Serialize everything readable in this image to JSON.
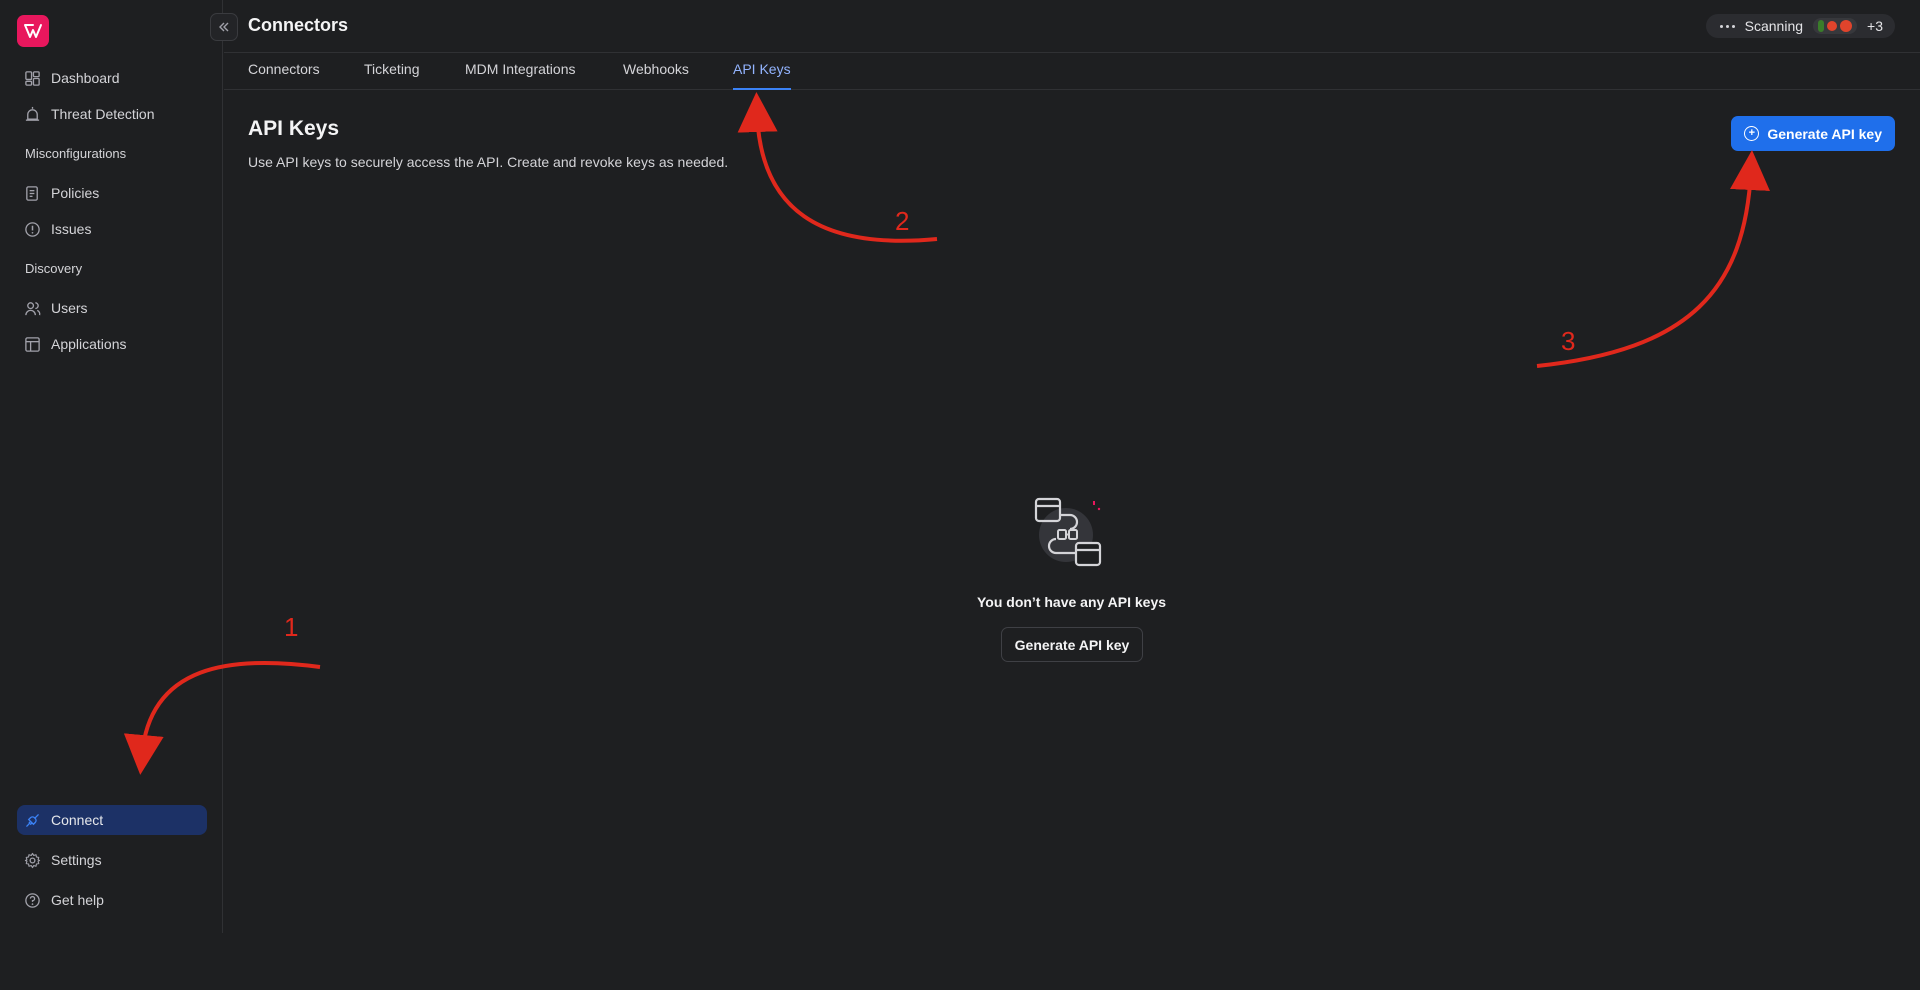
{
  "sidebar": {
    "items": [
      {
        "label": "Dashboard",
        "icon": "dashboard-icon"
      },
      {
        "label": "Threat Detection",
        "icon": "alarm-icon"
      },
      {
        "label": "Policies",
        "icon": "policy-icon"
      },
      {
        "label": "Issues",
        "icon": "alert-circle-icon"
      },
      {
        "label": "Users",
        "icon": "users-icon"
      },
      {
        "label": "Applications",
        "icon": "applications-icon"
      }
    ],
    "sections": [
      "Misconfigurations",
      "Discovery"
    ],
    "bottom": [
      {
        "label": "Connect",
        "icon": "plug-icon",
        "active": true
      },
      {
        "label": "Settings",
        "icon": "gear-icon"
      },
      {
        "label": "Get help",
        "icon": "help-icon"
      }
    ]
  },
  "header": {
    "title": "Connectors",
    "scan_status": "Scanning",
    "scan_extra": "+3"
  },
  "tabs": [
    "Connectors",
    "Ticketing",
    "MDM Integrations",
    "Webhooks",
    "API Keys"
  ],
  "active_tab": "API Keys",
  "content": {
    "title": "API Keys",
    "description": "Use API keys to securely access the API. Create and revoke keys as needed.",
    "generate_button": "Generate API key",
    "empty_text": "You don’t have any API keys",
    "empty_button": "Generate API key"
  },
  "annotations": [
    "1",
    "2",
    "3"
  ],
  "colors": {
    "accent": "#1f6feb",
    "brand": "#e8175d",
    "annotation": "#e0281c",
    "active_nav": "#1c3166"
  }
}
